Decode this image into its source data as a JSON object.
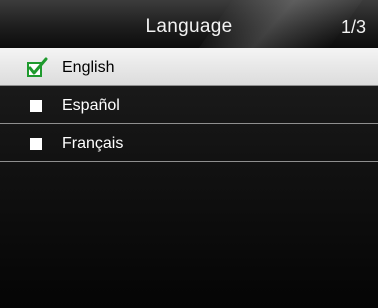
{
  "header": {
    "title": "Language",
    "page_indicator": "1/3"
  },
  "languages": [
    {
      "label": "English",
      "checked": true
    },
    {
      "label": "Español",
      "checked": false
    },
    {
      "label": "Français",
      "checked": false
    }
  ],
  "colors": {
    "selected_row": "#e6e6e6",
    "check_green": "#1f9a2e",
    "text_light": "#ffffff",
    "text_dark": "#000000"
  }
}
